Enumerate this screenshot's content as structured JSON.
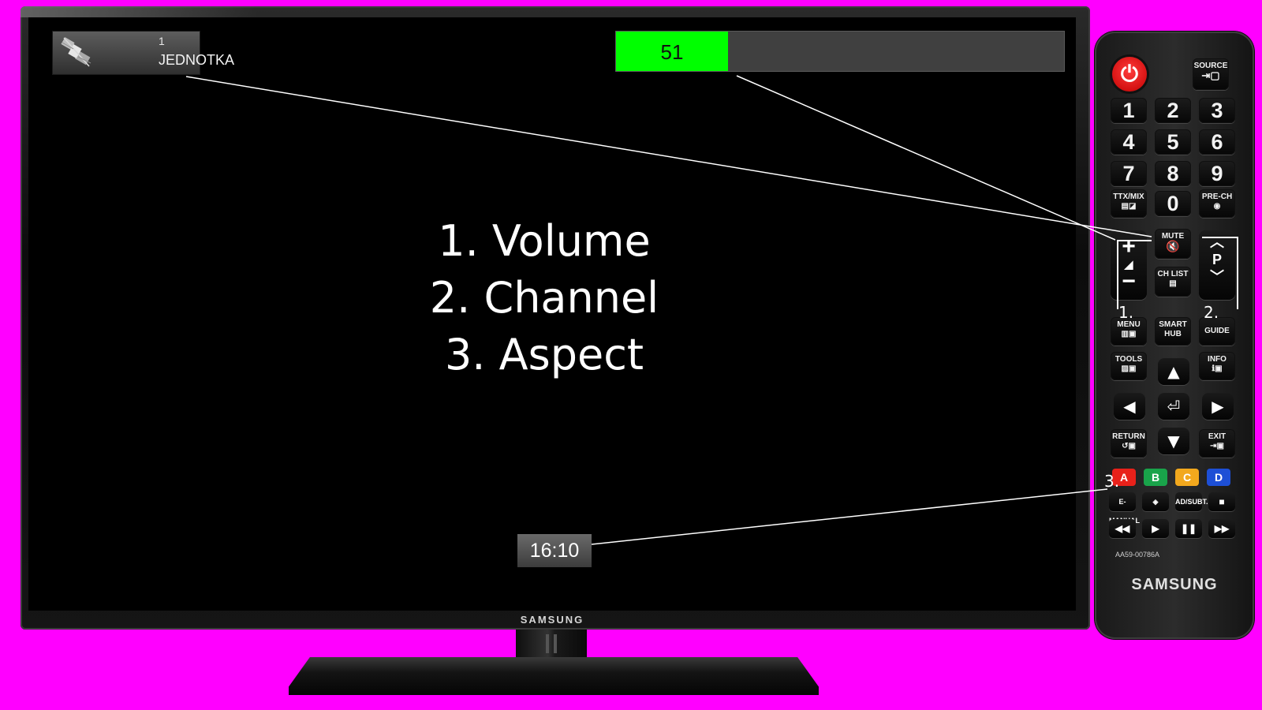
{
  "osd": {
    "channel": {
      "number": "1",
      "name": "JEDNOTKA",
      "icon": "satellite-icon"
    },
    "volume": {
      "value": "51",
      "level_fraction": 0.25,
      "fill_color": "#00ff00"
    },
    "legend": [
      "1. Volume",
      "2. Channel",
      "3. Aspect"
    ],
    "aspect": "16:10"
  },
  "tv": {
    "brand": "SAMSUNG"
  },
  "remote": {
    "source_label": "SOURCE",
    "digits": [
      "1",
      "2",
      "3",
      "4",
      "5",
      "6",
      "7",
      "8",
      "9"
    ],
    "ttx_label": "TTX/MIX",
    "zero": "0",
    "prech_label": "PRE-CH",
    "mute_label": "MUTE",
    "chlist_label": "CH LIST",
    "vol_plus": "+",
    "vol_minus": "−",
    "ch_label": "P",
    "menu_label": "MENU",
    "smarthub_label": "SMART HUB",
    "guide_label": "GUIDE",
    "tools_label": "TOOLS",
    "info_label": "INFO",
    "return_label": "RETURN",
    "exit_label": "EXIT",
    "colors": [
      {
        "label": "A",
        "color": "#e8211a"
      },
      {
        "label": "B",
        "color": "#19a34a"
      },
      {
        "label": "C",
        "color": "#f2a81d"
      },
      {
        "label": "D",
        "color": "#1d4fd6"
      }
    ],
    "emanual_label": "E-MANUAL",
    "adsubt_label": "AD/SUBT.",
    "model": "AA59-00786A",
    "brand": "SAMSUNG"
  },
  "annotations": {
    "volume_marker": "1.",
    "channel_marker": "2.",
    "aspect_marker": "3."
  },
  "colors": {
    "background": "#ff00ff",
    "screen": "#000000",
    "osd_text": "#ffffff"
  }
}
